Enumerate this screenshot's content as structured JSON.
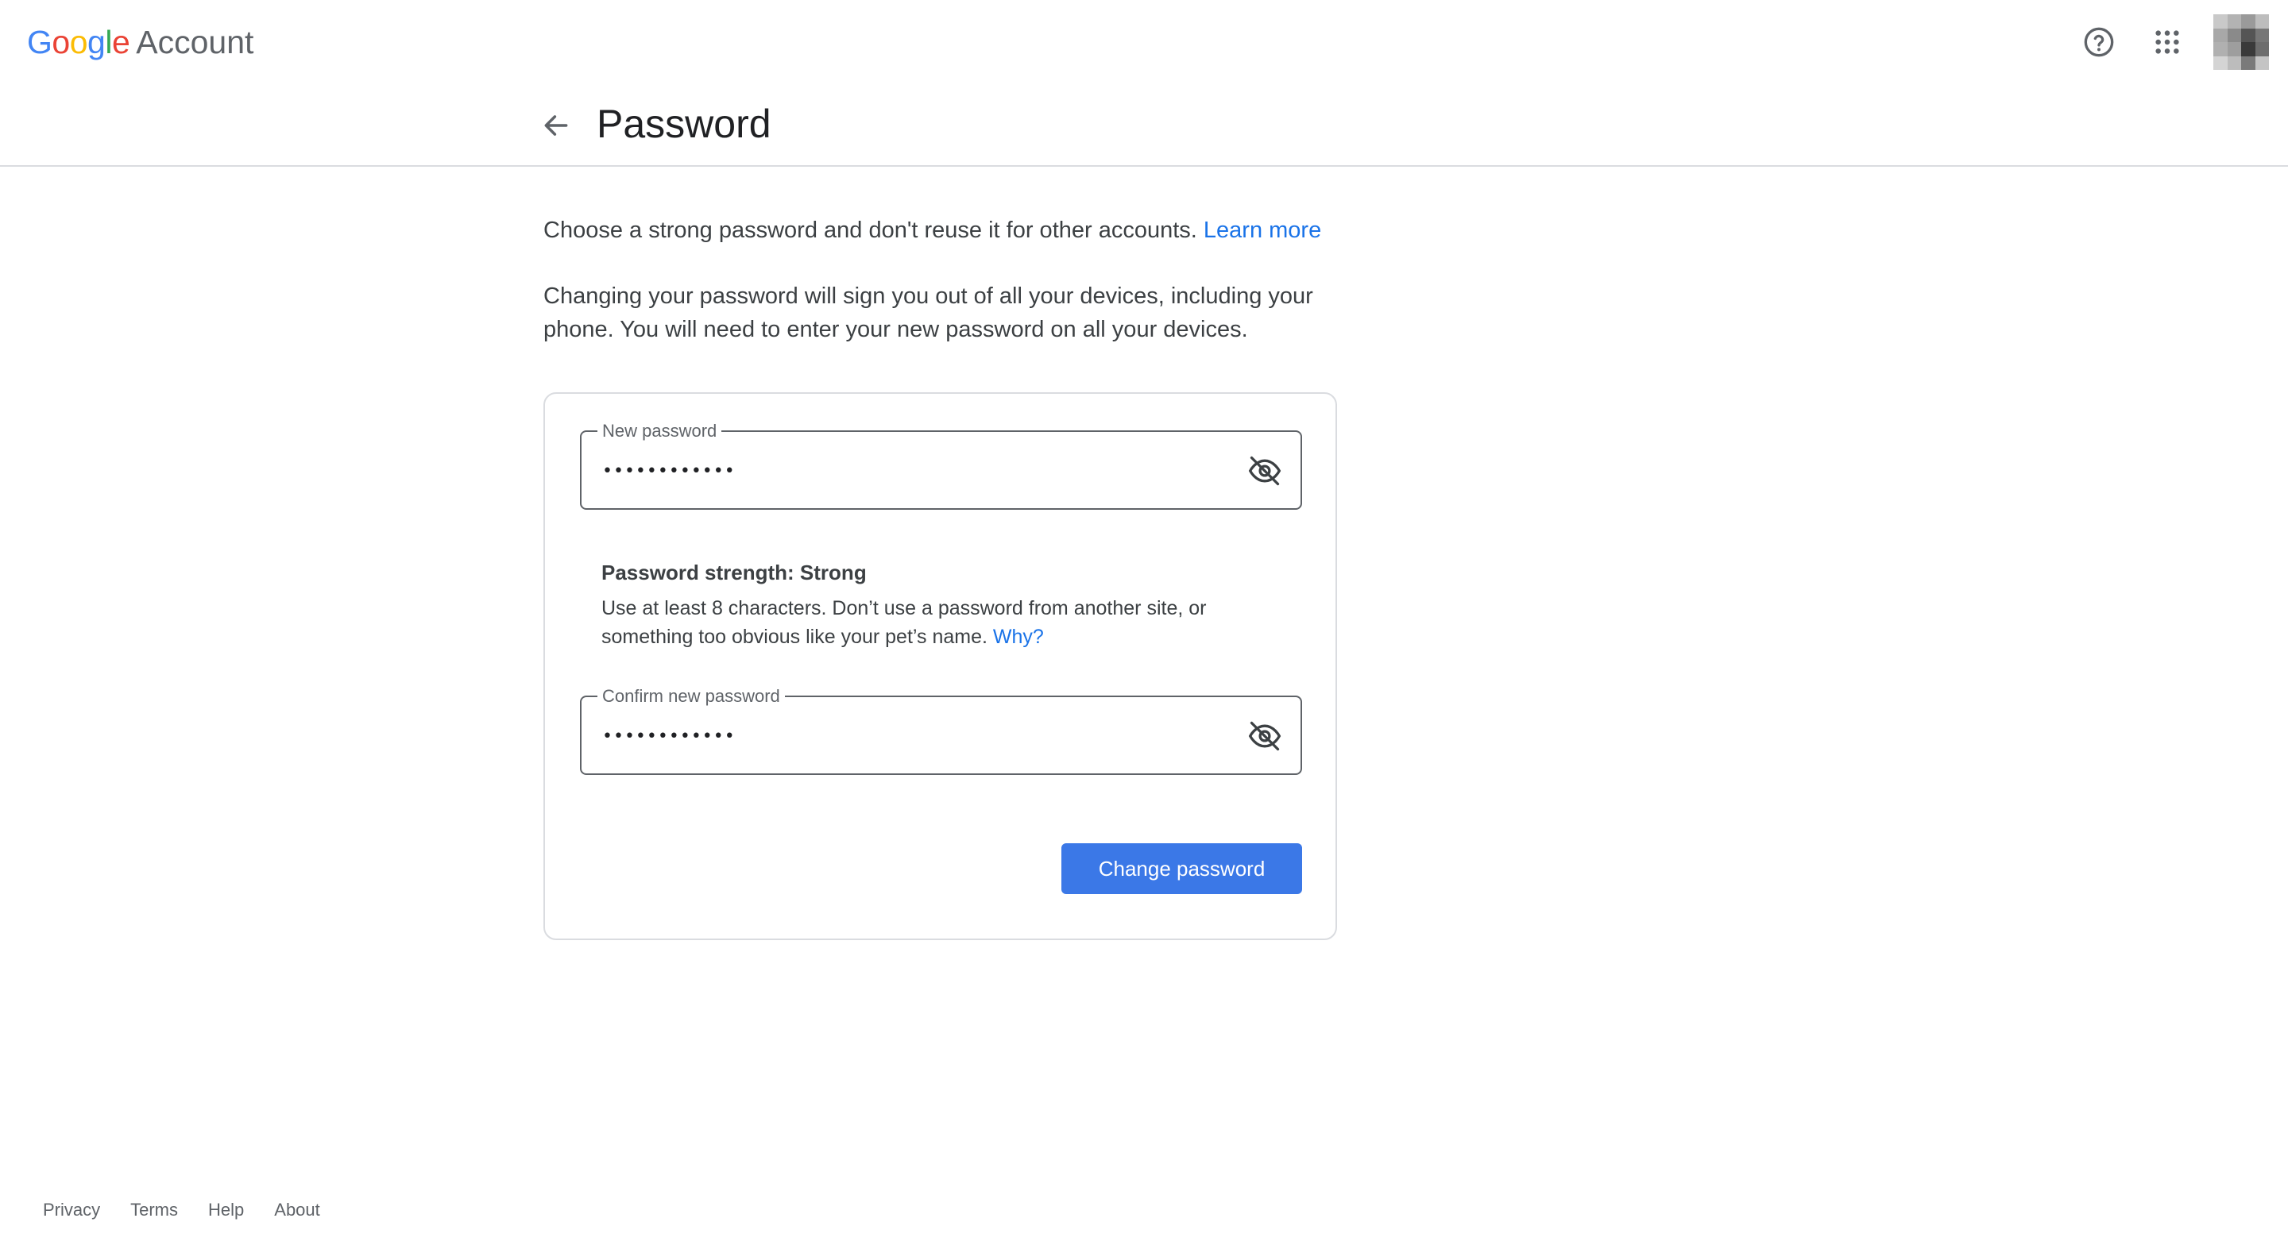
{
  "header": {
    "brand_google": "Google",
    "brand_account": "Account"
  },
  "page": {
    "title": "Password"
  },
  "intro": {
    "text": "Choose a strong password and don't reuse it for other accounts. ",
    "link": "Learn more"
  },
  "warning": "Changing your password will sign you out of all your devices, including your phone. You will need to enter your new password on all your devices.",
  "form": {
    "new_password_label": "New password",
    "new_password_value": "••••••••••••",
    "strength_title": "Password strength: Strong",
    "strength_desc": "Use at least 8 characters. Don’t use a password from another site, or something too obvious like your pet’s name. ",
    "strength_link": "Why?",
    "confirm_label": "Confirm new password",
    "confirm_value": "••••••••••••",
    "submit_label": "Change password"
  },
  "footer": {
    "links": [
      "Privacy",
      "Terms",
      "Help",
      "About"
    ]
  },
  "icons": {
    "help": "help-circle-icon",
    "apps": "apps-grid-icon",
    "back": "arrow-back-icon",
    "visibility": "visibility-off-icon"
  },
  "colors": {
    "accent": "#1a73e8",
    "button": "#3b78e7",
    "border": "#dadce0"
  }
}
